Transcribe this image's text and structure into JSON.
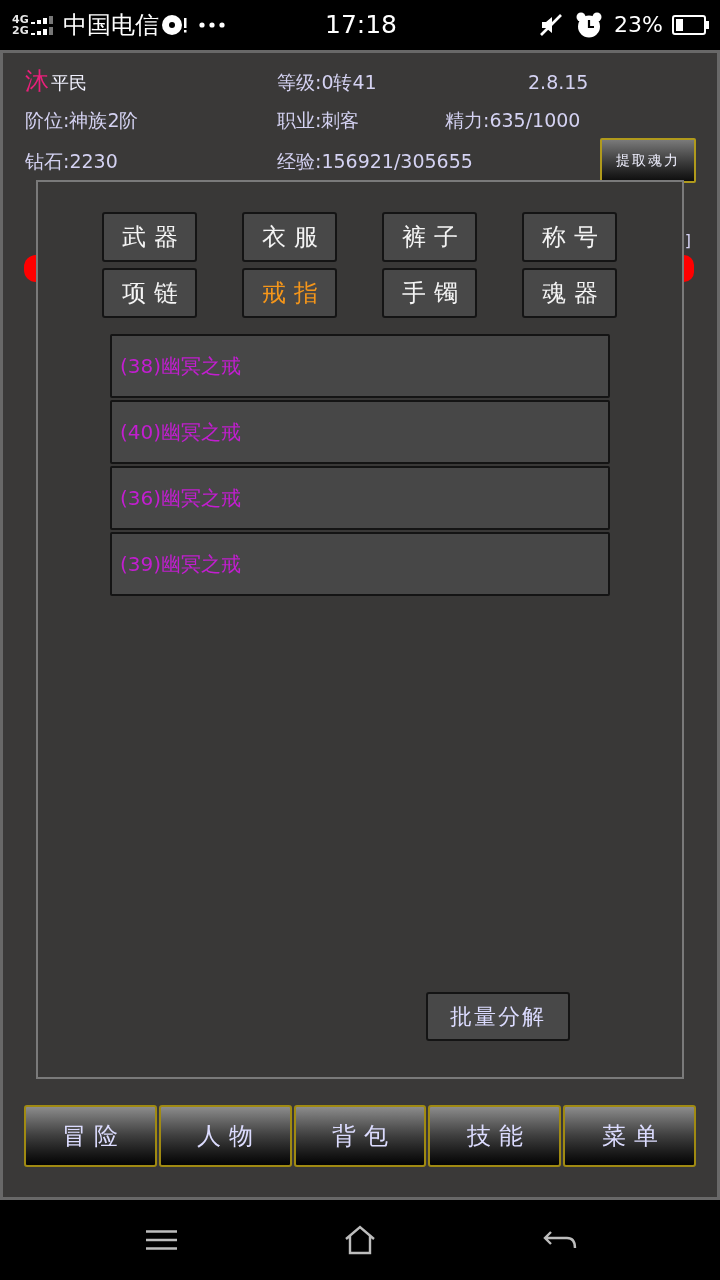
{
  "status_bar": {
    "network": [
      "4G",
      "2G"
    ],
    "carrier": "中国电信",
    "time": "17:18",
    "battery": "23%"
  },
  "player": {
    "name": "沐",
    "title": "平民",
    "level": "等级:0转41",
    "version": "2.8.15",
    "tier": "阶位:神族2阶",
    "job": "职业:刺客",
    "energy": "精力:635/1000",
    "diamonds": "钻石:2230",
    "experience": "经验:156921/305655"
  },
  "extract_button": "提取魂力",
  "background": {
    "bracket": "]"
  },
  "dialog": {
    "tabs": [
      {
        "label": "武器",
        "selected": false
      },
      {
        "label": "衣服",
        "selected": false
      },
      {
        "label": "裤子",
        "selected": false
      },
      {
        "label": "称号",
        "selected": false
      },
      {
        "label": "项链",
        "selected": false
      },
      {
        "label": "戒指",
        "selected": true
      },
      {
        "label": "手镯",
        "selected": false
      },
      {
        "label": "魂器",
        "selected": false
      }
    ],
    "items": [
      "(38)幽冥之戒",
      "(40)幽冥之戒",
      "(36)幽冥之戒",
      "(39)幽冥之戒"
    ],
    "batch_button": "批量分解"
  },
  "nav_buttons": [
    "冒险",
    "人物",
    "背包",
    "技能",
    "菜单"
  ]
}
